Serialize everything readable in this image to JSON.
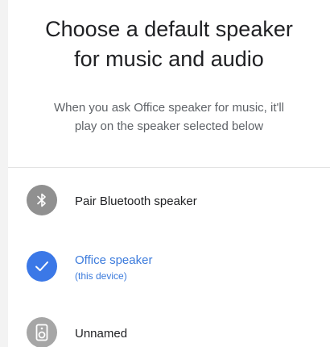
{
  "dialog": {
    "title_line1": "Choose a default speaker",
    "title_line2": "for music and audio",
    "subtitle_line1": "When you ask Office speaker for music, it'll",
    "subtitle_line2": "play on the speaker selected below"
  },
  "speakers": [
    {
      "label": "Pair Bluetooth speaker",
      "icon": "bluetooth-icon",
      "selected": false
    },
    {
      "label": "Office speaker",
      "sublabel": "(this device)",
      "icon": "checkmark-icon",
      "selected": true
    },
    {
      "label": "Unnamed",
      "icon": "speaker-icon",
      "selected": false
    }
  ],
  "colors": {
    "accent": "#3b78e7",
    "selected_text": "#3c7bdc",
    "icon_gray": "#909090",
    "text_primary": "#202124",
    "text_secondary": "#5f6368"
  }
}
